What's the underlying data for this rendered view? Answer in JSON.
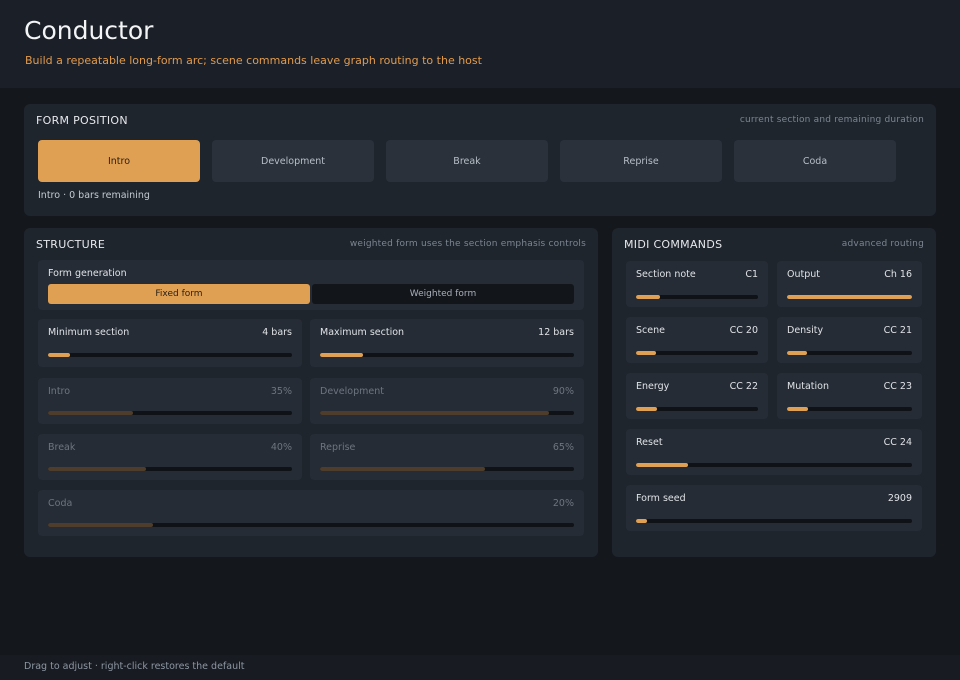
{
  "app": {
    "title": "Conductor",
    "subtitle": "Build a repeatable long-form arc; scene commands leave graph routing to the host"
  },
  "form_position": {
    "title": "FORM POSITION",
    "hint": "current section and remaining duration",
    "sections": [
      "Intro",
      "Development",
      "Break",
      "Reprise",
      "Coda"
    ],
    "active": "Intro",
    "status": "Intro · 0 bars remaining"
  },
  "structure": {
    "title": "STRUCTURE",
    "hint": "weighted form uses the section emphasis controls",
    "generation": {
      "label": "Form generation",
      "options": [
        "Fixed form",
        "Weighted form"
      ],
      "selected": "Fixed form"
    },
    "min_section": {
      "label": "Minimum section",
      "value": "4 bars",
      "level": 0.09
    },
    "max_section": {
      "label": "Maximum section",
      "value": "12 bars",
      "level": 0.17
    },
    "emphasis": {
      "intro": {
        "label": "Intro",
        "value": "35%",
        "level": 0.35
      },
      "development": {
        "label": "Development",
        "value": "90%",
        "level": 0.9
      },
      "break": {
        "label": "Break",
        "value": "40%",
        "level": 0.4
      },
      "reprise": {
        "label": "Reprise",
        "value": "65%",
        "level": 0.65
      },
      "coda": {
        "label": "Coda",
        "value": "20%",
        "level": 0.2
      }
    }
  },
  "midi": {
    "title": "MIDI COMMANDS",
    "hint": "advanced routing",
    "section_note": {
      "label": "Section note",
      "value": "C1",
      "level": 0.2
    },
    "output": {
      "label": "Output",
      "value": "Ch 16",
      "level": 1.0
    },
    "scene": {
      "label": "Scene",
      "value": "CC 20",
      "level": 0.16
    },
    "density": {
      "label": "Density",
      "value": "CC 21",
      "level": 0.16
    },
    "energy": {
      "label": "Energy",
      "value": "CC 22",
      "level": 0.17
    },
    "mutation": {
      "label": "Mutation",
      "value": "CC 23",
      "level": 0.17
    },
    "reset": {
      "label": "Reset",
      "value": "CC 24",
      "level": 0.19
    },
    "form_seed": {
      "label": "Form seed",
      "value": "2909",
      "level": 0.04
    }
  },
  "footer": {
    "hint": "Drag to adjust · right-click restores the default"
  },
  "colors": {
    "accent": "#e0a054",
    "background": "#14171c",
    "panel": "#1f252d"
  }
}
